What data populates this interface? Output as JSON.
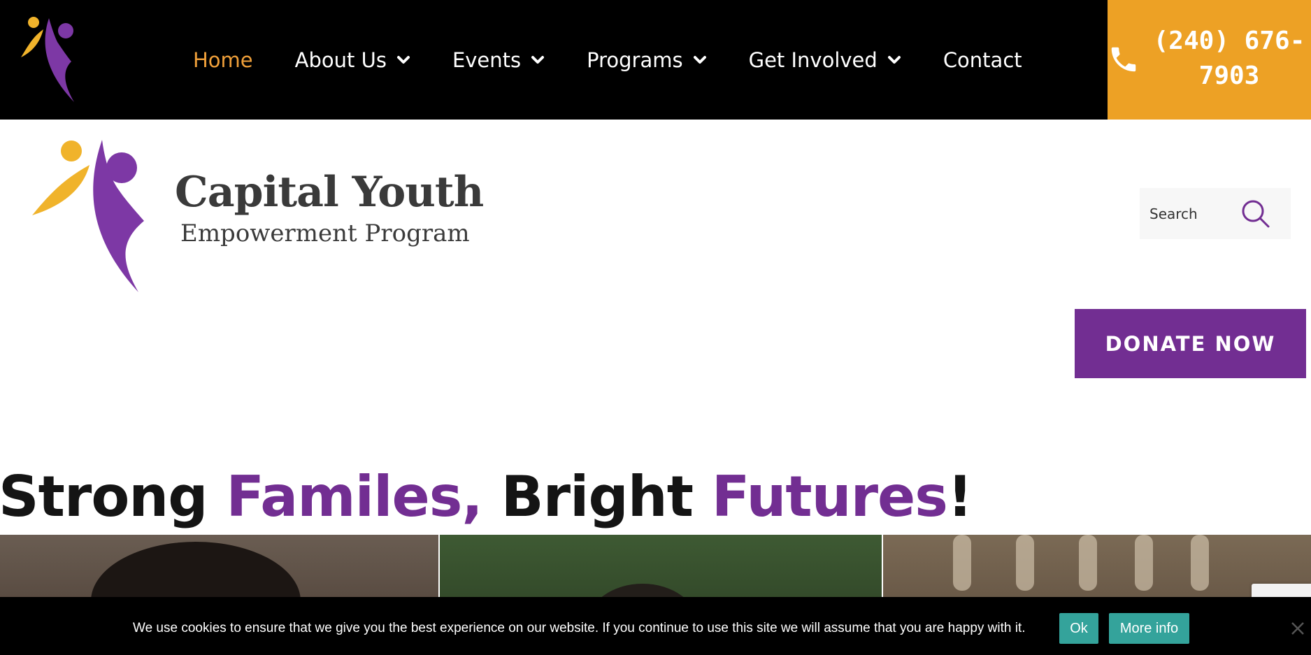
{
  "nav": {
    "items": [
      {
        "label": "Home",
        "active": true,
        "dropdown": false
      },
      {
        "label": "About Us",
        "active": false,
        "dropdown": true
      },
      {
        "label": "Events",
        "active": false,
        "dropdown": true
      },
      {
        "label": "Programs",
        "active": false,
        "dropdown": true
      },
      {
        "label": "Get Involved",
        "active": false,
        "dropdown": true
      },
      {
        "label": "Contact",
        "active": false,
        "dropdown": false
      }
    ],
    "phone": "(240) 676-7903"
  },
  "header": {
    "brand_name": "Capital Youth",
    "brand_sub": "Empowerment Program",
    "search_placeholder": "Search",
    "donate_label": "DONATE NOW"
  },
  "hero": {
    "headline_parts": [
      {
        "text": "Strong ",
        "color": "#141414"
      },
      {
        "text": "Familes,",
        "color": "#722e92"
      },
      {
        "text": " Bright ",
        "color": "#141414"
      },
      {
        "text": "Futures",
        "color": "#722e92"
      },
      {
        "text": "!",
        "color": "#141414"
      }
    ]
  },
  "cookie": {
    "message": "We use cookies to ensure that we give you the best experience on our website. If you continue to use this site we will assume that you are happy with it.",
    "ok_label": "Ok",
    "more_label": "More info"
  },
  "colors": {
    "brand_purple": "#722e92",
    "brand_orange": "#eda125",
    "nav_active": "#f0a03a",
    "cookie_button": "#34a39b"
  },
  "icons": [
    "logo-mark",
    "chevron-down-icon",
    "phone-icon",
    "search-icon",
    "close-icon"
  ]
}
